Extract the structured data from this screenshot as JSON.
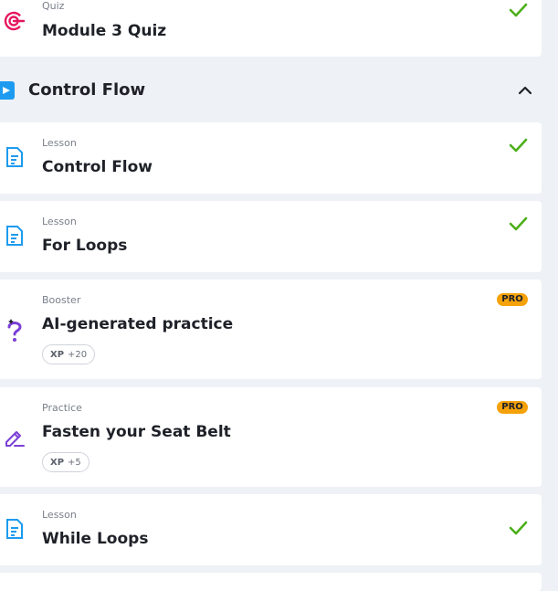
{
  "section": {
    "title": "Control Flow",
    "icon": "play-icon",
    "expanded": true
  },
  "items": [
    {
      "type": "Quiz",
      "title": "Module 3 Quiz",
      "icon": "target-icon",
      "completed": true
    },
    {
      "type": "Lesson",
      "title": "Control Flow",
      "icon": "lesson-doc-icon",
      "completed": true
    },
    {
      "type": "Lesson",
      "title": "For Loops",
      "icon": "lesson-doc-icon",
      "completed": true
    },
    {
      "type": "Booster",
      "title": "AI-generated practice",
      "icon": "question-sparkle-icon",
      "badge": "PRO",
      "xp_label": "XP",
      "xp_value": "+20"
    },
    {
      "type": "Practice",
      "title": "Fasten your Seat Belt",
      "icon": "edit-pencil-icon",
      "badge": "PRO",
      "xp_label": "XP",
      "xp_value": "+5"
    },
    {
      "type": "Lesson",
      "title": "While Loops",
      "icon": "lesson-doc-icon",
      "completed": true
    }
  ],
  "colors": {
    "accent_blue": "#1d9bf0",
    "check_green": "#4caf1a",
    "pro_orange": "#f5a20a",
    "quiz_pink": "#e5175f",
    "booster_purple": "#7b3fd6"
  }
}
